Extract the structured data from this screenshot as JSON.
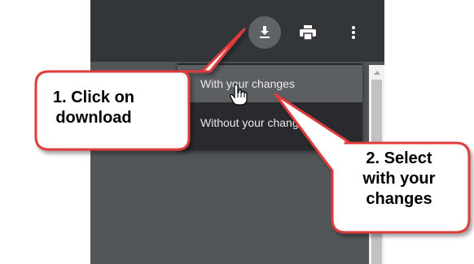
{
  "toolbar": {
    "download_icon": "download-icon",
    "print_icon": "print-icon",
    "more_icon": "more-vert-icon"
  },
  "download_menu": {
    "items": [
      {
        "label": "With your changes",
        "highlighted": true
      },
      {
        "label": "Without your changes",
        "highlighted": false
      }
    ]
  },
  "callouts": [
    {
      "text_lines": [
        "1. Click on",
        "download"
      ]
    },
    {
      "text_lines": [
        "2. Select",
        "with your",
        "changes"
      ]
    }
  ],
  "colors": {
    "toolbar": "#323639",
    "viewer": "#525659",
    "menu": "#292a2d",
    "menu_hover": "#5c5f62",
    "callout_fill": "#ffffff",
    "callout_border": "#e03a3a"
  }
}
